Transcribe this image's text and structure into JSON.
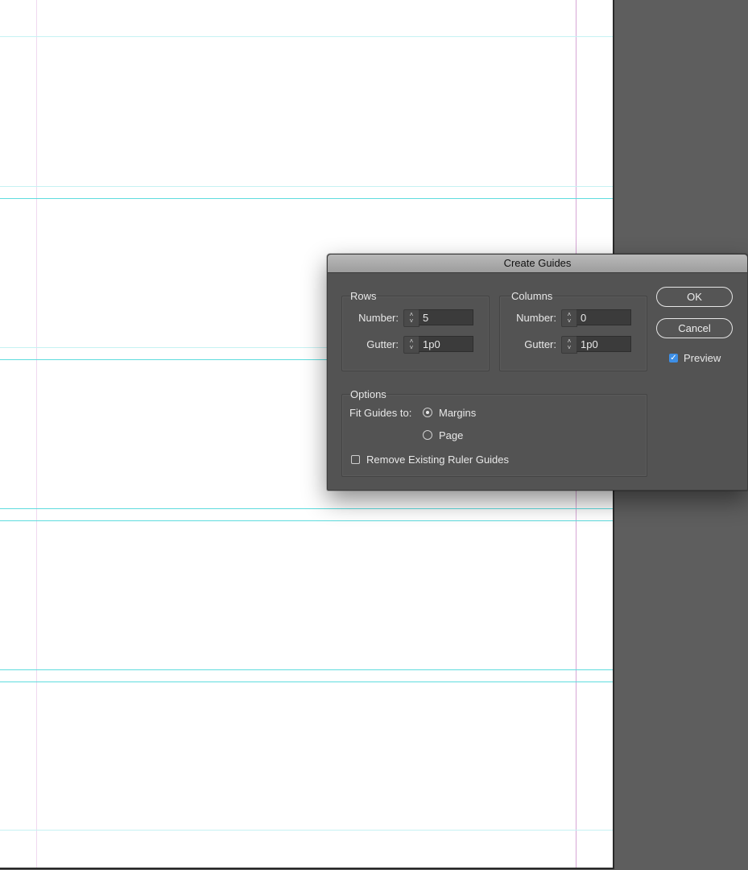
{
  "dialog": {
    "title": "Create Guides",
    "rows": {
      "title": "Rows",
      "number_label": "Number:",
      "number_value": "5",
      "gutter_label": "Gutter:",
      "gutter_value": "1p0"
    },
    "columns": {
      "title": "Columns",
      "number_label": "Number:",
      "number_value": "0",
      "gutter_label": "Gutter:",
      "gutter_value": "1p0"
    },
    "buttons": {
      "ok": "OK",
      "cancel": "Cancel"
    },
    "preview": {
      "label": "Preview",
      "checked": true
    },
    "options": {
      "title": "Options",
      "fit_label": "Fit Guides to:",
      "fit_choices": [
        {
          "label": "Margins",
          "selected": true
        },
        {
          "label": "Page",
          "selected": false
        }
      ],
      "remove_existing_label": "Remove Existing Ruler Guides",
      "remove_existing_checked": false
    }
  },
  "icons": {
    "stepper": "stepper-up-down-icon",
    "check": "checkmark-icon"
  },
  "colors": {
    "guide": "#5fdcde",
    "margin_guide": "#d7a6d6",
    "dialog_bg": "#535353",
    "pasteboard": "#5e5e5e",
    "check_accent": "#3d8fe6"
  }
}
